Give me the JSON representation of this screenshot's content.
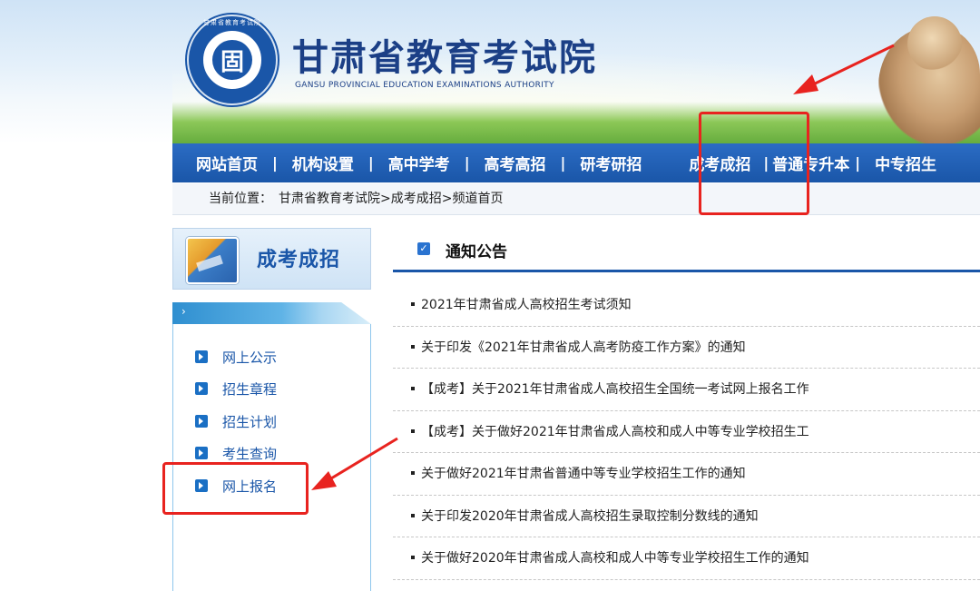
{
  "header": {
    "emblem_glyph": "固",
    "emblem_ring_text": "甘肃省教育考试院",
    "title": "甘肃省教育考试院",
    "subtitle": "GANSU PROVINCIAL EDUCATION EXAMINATIONS AUTHORITY"
  },
  "nav": {
    "items": [
      "网站首页",
      "机构设置",
      "高中学考",
      "高考高招",
      "研考研招",
      "成考成招",
      "普通专升本",
      "中专招生"
    ],
    "separator": "|"
  },
  "breadcrumb": {
    "label": "当前位置：",
    "trail": [
      "甘肃省教育考试院",
      "成考成招",
      "频道首页"
    ],
    "divider": ">"
  },
  "sidebar": {
    "title": "成考成招",
    "bar_arrow": "›",
    "items": [
      "网上公示",
      "招生章程",
      "招生计划",
      "考生查询",
      "网上报名"
    ]
  },
  "notices": {
    "title": "通知公告",
    "items": [
      "2021年甘肃省成人高校招生考试须知",
      "关于印发《2021年甘肃省成人高考防疫工作方案》的通知",
      "【成考】关于2021年甘肃省成人高校招生全国统一考试网上报名工作",
      "【成考】关于做好2021年甘肃省成人高校和成人中等专业学校招生工",
      "关于做好2021年甘肃省普通中等专业学校招生工作的通知",
      "关于印发2020年甘肃省成人高校招生录取控制分数线的通知",
      "关于做好2020年甘肃省成人高校和成人中等专业学校招生工作的通知"
    ]
  },
  "annotations": {
    "color": "#e8231f"
  },
  "colors": {
    "brand_blue": "#1a56a8",
    "nav_blue": "#2b6cc4"
  }
}
